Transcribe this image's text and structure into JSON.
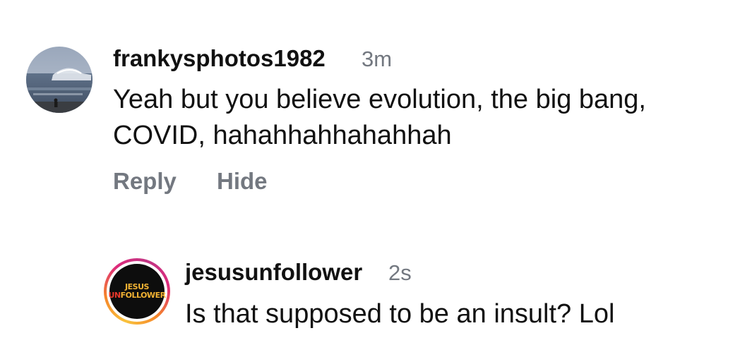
{
  "comments": [
    {
      "username": "frankysphotos1982",
      "time": "3m",
      "text": "Yeah but you believe evolution, the big bang, COVID, hahahhahhahahhah",
      "actions": {
        "reply": "Reply",
        "hide": "Hide"
      }
    },
    {
      "username": "jesusunfollower",
      "time": "2s",
      "text": "Is that supposed to be an insult? Lol",
      "avatar_logo": {
        "line1": "JESUS",
        "line2_prefix": "UN",
        "line2_rest": "FOLLOWER"
      }
    }
  ],
  "colors": {
    "text": "#111111",
    "muted": "#737880",
    "logo_gold": "#f2b233",
    "logo_red": "#e8382b"
  }
}
